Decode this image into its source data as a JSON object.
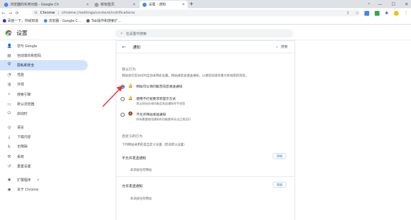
{
  "tabs": [
    {
      "title": "浏览器的实用功能 - Google Ch",
      "color": "#4285f4"
    },
    {
      "title": "新标签页",
      "color": "#9aa0a6"
    },
    {
      "title": "设置 - 通知",
      "color": "#4285f4"
    }
  ],
  "toolbar": {
    "origin": "Chrome",
    "separator": "|",
    "url": "chrome://settings/content/notifications"
  },
  "bookmarks": [
    {
      "label": "百度一下，你就知道",
      "color": "#2932e1"
    },
    {
      "label": "浏览器 - Google C...",
      "color": "#4285f4"
    },
    {
      "label": "Tab操作和搜索扩...",
      "color": "#5f6368"
    }
  ],
  "header": {
    "title": "设置",
    "search_placeholder": "在设置中搜索"
  },
  "sidebar": {
    "items": [
      {
        "label": "您与 Google",
        "icon": "person-icon"
      },
      {
        "label": "自动填充和密码",
        "icon": "clipboard-icon"
      },
      {
        "label": "隐私和安全",
        "icon": "shield-icon",
        "selected": true
      },
      {
        "label": "性能",
        "icon": "speedometer-icon"
      },
      {
        "label": "外观",
        "icon": "palette-icon"
      },
      {
        "label": "搜索引擎",
        "icon": "search-icon"
      },
      {
        "label": "默认浏览器",
        "icon": "browser-icon"
      },
      {
        "label": "启动时",
        "icon": "power-icon"
      },
      {
        "label": "语言",
        "icon": "globe-icon"
      },
      {
        "label": "下载内容",
        "icon": "download-icon"
      },
      {
        "label": "无障碍",
        "icon": "accessibility-icon"
      },
      {
        "label": "系统",
        "icon": "wrench-icon"
      },
      {
        "label": "重置设置",
        "icon": "reset-icon"
      },
      {
        "label": "扩展程序",
        "icon": "puzzle-icon"
      },
      {
        "label": "关于 Chrome",
        "icon": "chrome-icon"
      }
    ]
  },
  "content": {
    "page_title": "通知",
    "search_label": "搜索",
    "default_behavior": {
      "heading": "默认行为",
      "description": "网站会在您访问时自动采用此设置。网站通常会発送通知，以便您知道有重大新闻或新消息。"
    },
    "options": [
      {
        "label": "网站可以询问能否向您发送通知",
        "sublabel": "",
        "icon": "bell-icon",
        "checked": true
      },
      {
        "label": "使用不打扰要求的提示方式",
        "sublabel": "禁止网站在询问能否发送通知时干扰您",
        "icon": "bell-icon",
        "checked": false
      },
      {
        "label": "不允许网站发送通知",
        "sublabel": "所有需要使用通知的功能都将无法正常运行",
        "icon": "bell-off-icon",
        "checked": false
      }
    ],
    "custom": {
      "heading": "自定义的行为",
      "description": "下列网站采用的是自定义设置（而非默认设置）"
    },
    "block_section": {
      "heading": "不允许发送通知",
      "add_label": "添加",
      "empty": "未添加任何网站"
    },
    "allow_section": {
      "heading": "允许发送通知",
      "add_label": "添加",
      "empty": "未添加任何网站"
    }
  },
  "colors": {
    "accent": "#1a73e8",
    "selected_bg": "#d3e3fd",
    "annotation": "#e53935"
  }
}
